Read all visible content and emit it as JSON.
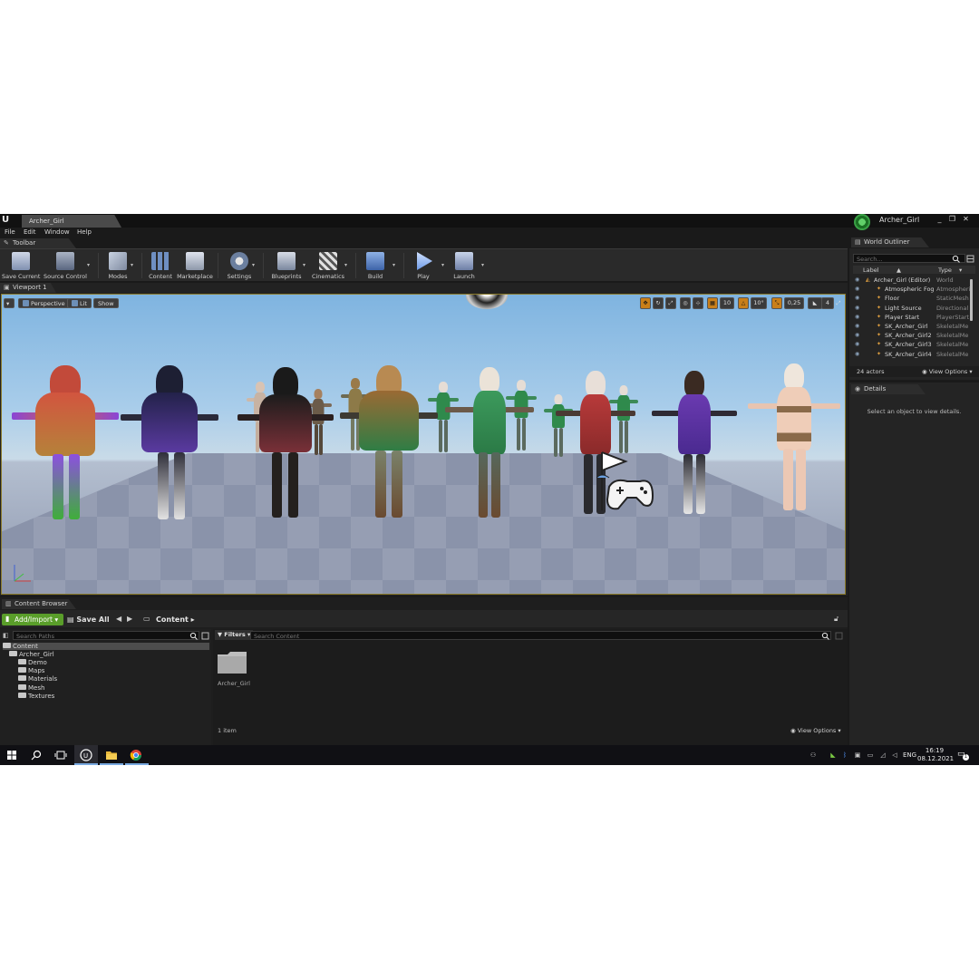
{
  "window": {
    "tab_title": "Archer_Girl",
    "project_name": "Archer_Girl",
    "controls": [
      "_",
      "❐",
      "✕"
    ]
  },
  "menu": [
    "File",
    "Edit",
    "Window",
    "Help"
  ],
  "toolbar": {
    "tab_label": "Toolbar",
    "buttons": [
      {
        "label": "Save Current",
        "icon": "save-icon"
      },
      {
        "label": "Source Control",
        "icon": "source-control-icon"
      },
      {
        "label": "Modes",
        "icon": "modes-icon"
      },
      {
        "label": "Content",
        "icon": "content-icon"
      },
      {
        "label": "Marketplace",
        "icon": "marketplace-icon"
      },
      {
        "label": "Settings",
        "icon": "settings-icon"
      },
      {
        "label": "Blueprints",
        "icon": "blueprints-icon"
      },
      {
        "label": "Cinematics",
        "icon": "cinematics-icon"
      },
      {
        "label": "Build",
        "icon": "build-icon"
      },
      {
        "label": "Play",
        "icon": "play-icon"
      },
      {
        "label": "Launch",
        "icon": "launch-icon"
      }
    ]
  },
  "viewport": {
    "tab_label": "Viewport 1",
    "perspective_label": "Perspective",
    "lit_label": "Lit",
    "show_label": "Show",
    "grid_snap": "10",
    "rotation_snap": "10°",
    "scale_snap": "0,25",
    "camera_speed": "4"
  },
  "outliner": {
    "tab_label": "World Outliner",
    "search_placeholder": "Search...",
    "col_label": "Label",
    "col_type": "Type",
    "rows": [
      {
        "name": "Archer_Girl (Editor)",
        "type": "World"
      },
      {
        "name": "Atmospheric Fog",
        "type": "Atmospheric"
      },
      {
        "name": "Floor",
        "type": "StaticMesh"
      },
      {
        "name": "Light Source",
        "type": "Directional"
      },
      {
        "name": "Player Start",
        "type": "PlayerStart"
      },
      {
        "name": "SK_Archer_Girl",
        "type": "SkeletalMe"
      },
      {
        "name": "SK_Archer_Girl2",
        "type": "SkeletalMe"
      },
      {
        "name": "SK_Archer_Girl3",
        "type": "SkeletalMe"
      },
      {
        "name": "SK_Archer_Girl4",
        "type": "SkeletalMe"
      }
    ],
    "actor_count": "24 actors",
    "view_options": "View Options"
  },
  "details": {
    "tab_label": "Details",
    "empty_message": "Select an object to view details."
  },
  "content_browser": {
    "tab_label": "Content Browser",
    "add_import": "Add/Import",
    "save_all": "Save All",
    "path": "Content",
    "search_paths_placeholder": "Search Paths",
    "filters_label": "Filters",
    "search_content_placeholder": "Search Content",
    "tree": [
      {
        "label": "Content",
        "level": 0
      },
      {
        "label": "Archer_Girl",
        "level": 1
      },
      {
        "label": "Demo",
        "level": 2
      },
      {
        "label": "Maps",
        "level": 2
      },
      {
        "label": "Materials",
        "level": 2
      },
      {
        "label": "Mesh",
        "level": 2
      },
      {
        "label": "Textures",
        "level": 2
      }
    ],
    "asset_folder": "Archer_Girl",
    "item_count": "1 item",
    "view_options": "View Options"
  },
  "taskbar": {
    "language": "ENG",
    "time": "16:19",
    "date": "08.12.2021",
    "notification_count": "1"
  },
  "colors": {
    "accent_green": "#5a9e2a",
    "snap_orange": "#c97f19",
    "panel_bg": "#242424"
  }
}
